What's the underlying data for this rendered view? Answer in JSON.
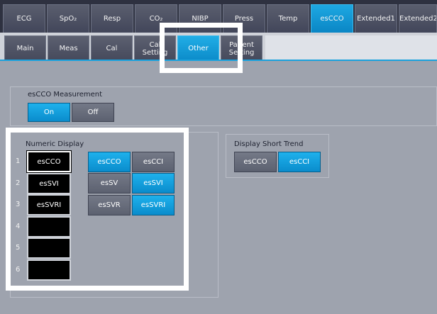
{
  "tabs_top": [
    "ECG",
    "SpO₂",
    "Resp",
    "CO₂",
    "NIBP",
    "Press",
    "Temp",
    "esCCO",
    "Extended1",
    "Extended2"
  ],
  "tabs_top_active": "esCCO",
  "tabs_sub": [
    "Main",
    "Meas",
    "Cal",
    "Cal\nSetting",
    "Other",
    "Patient\nSetting"
  ],
  "tabs_sub_active": "Other",
  "measurement": {
    "title": "esCCO Measurement",
    "on_label": "On",
    "off_label": "Off",
    "selected": "On"
  },
  "numeric_display": {
    "title": "Numeric Display",
    "rows": [
      {
        "num": "1",
        "value": "esCCO"
      },
      {
        "num": "2",
        "value": "esSVI"
      },
      {
        "num": "3",
        "value": "esSVRI"
      },
      {
        "num": "4",
        "value": ""
      },
      {
        "num": "5",
        "value": ""
      },
      {
        "num": "6",
        "value": ""
      }
    ],
    "options": [
      {
        "label": "esCCO",
        "on": true
      },
      {
        "label": "esCCI",
        "on": false
      },
      {
        "label": "esSV",
        "on": false
      },
      {
        "label": "esSVI",
        "on": true
      },
      {
        "label": "esSVR",
        "on": false
      },
      {
        "label": "esSVRI",
        "on": true
      }
    ]
  },
  "short_trend": {
    "title": "Display Short Trend",
    "options": [
      {
        "label": "esCCO",
        "on": false
      },
      {
        "label": "esCCI",
        "on": true
      }
    ]
  },
  "colors": {
    "accent": "#0a8ccc",
    "tab_active": "#1ea8e2",
    "background": "#9ea3ae"
  }
}
